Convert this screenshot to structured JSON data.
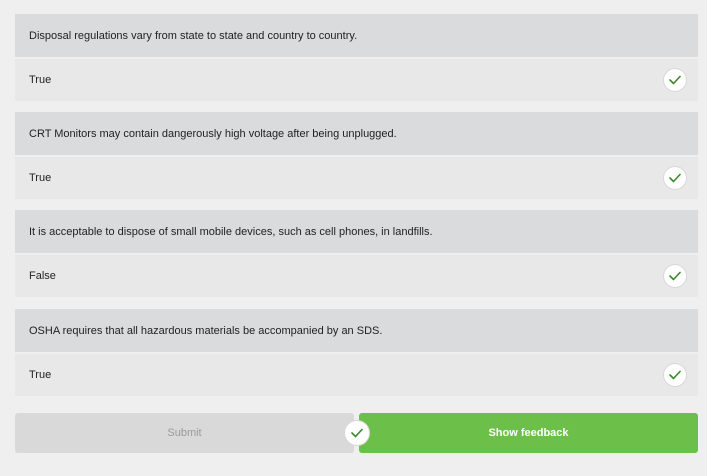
{
  "questions": [
    {
      "text": "Disposal regulations vary from state to state and country to country.",
      "answer": "True",
      "status_icon": "check-icon"
    },
    {
      "text": "CRT Monitors may contain dangerously high voltage after being unplugged.",
      "answer": "True",
      "status_icon": "check-icon"
    },
    {
      "text": "It is acceptable to dispose of small mobile devices, such as cell phones, in landfills.",
      "answer": "False",
      "status_icon": "check-icon"
    },
    {
      "text": "OSHA requires that all hazardous materials be accompanied by an SDS.",
      "answer": "True",
      "status_icon": "check-icon"
    }
  ],
  "buttons": {
    "submit_label": "Submit",
    "feedback_label": "Show feedback"
  },
  "colors": {
    "accent_green": "#6cc04a",
    "check_green": "#3a8a2a",
    "question_bg": "#dadbdd",
    "answer_bg": "#e8e8e8"
  }
}
